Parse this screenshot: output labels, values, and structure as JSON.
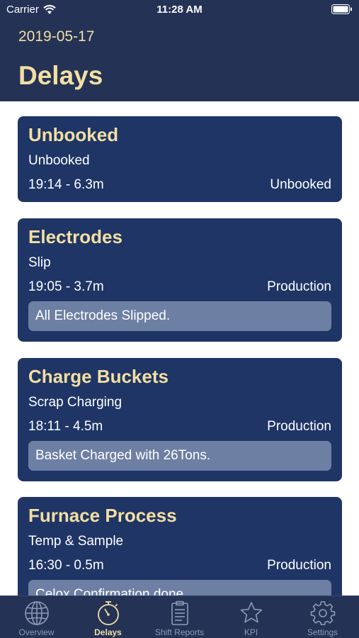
{
  "status_bar": {
    "carrier": "Carrier",
    "time": "11:28 AM"
  },
  "header": {
    "date": "2019-05-17",
    "title": "Delays"
  },
  "delays": [
    {
      "title": "Unbooked",
      "subtitle": "Unbooked",
      "time": "19:14 - 6.3m",
      "category": "Unbooked",
      "note": ""
    },
    {
      "title": "Electrodes",
      "subtitle": "Slip",
      "time": "19:05 - 3.7m",
      "category": "Production",
      "note": "All Electrodes Slipped."
    },
    {
      "title": "Charge Buckets",
      "subtitle": "Scrap Charging",
      "time": "18:11 - 4.5m",
      "category": "Production",
      "note": "Basket Charged with 26Tons."
    },
    {
      "title": "Furnace Process",
      "subtitle": "Temp & Sample",
      "time": "16:30 - 0.5m",
      "category": "Production",
      "note": "Celox Confirmation done."
    }
  ],
  "tabbar": {
    "active": "Delays",
    "tabs": [
      {
        "label": "Overview",
        "icon": "globe-icon"
      },
      {
        "label": "Delays",
        "icon": "stopwatch-icon"
      },
      {
        "label": "Shift Reports",
        "icon": "clipboard-icon"
      },
      {
        "label": "KPI",
        "icon": "star-icon"
      },
      {
        "label": "Settings",
        "icon": "gear-icon"
      }
    ]
  },
  "colors": {
    "header_bg": "#243256",
    "card_bg": "#1e3565",
    "accent": "#f3dfa2",
    "note_bg": "#6d7fa3"
  }
}
